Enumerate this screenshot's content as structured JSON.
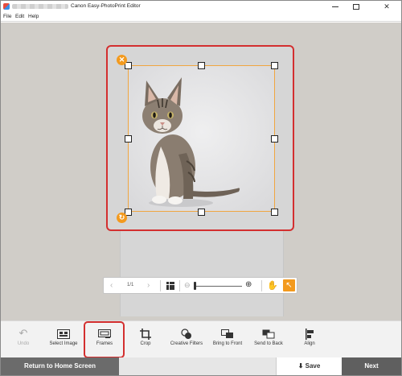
{
  "window": {
    "title": "Canon Easy-PhotoPrint Editor",
    "minimize_glyph": "—",
    "close_glyph": "✕"
  },
  "menu": {
    "file": "File",
    "edit": "Edit",
    "help": "Help"
  },
  "canvas": {
    "delete_glyph": "✕",
    "rotate_glyph": "↻",
    "photo_subject_icon": "kitten-photo"
  },
  "navigation": {
    "prev_glyph": "‹",
    "next_glyph": "›",
    "page_indicator": "1/1",
    "zoom_out_glyph": "⊖",
    "zoom_in_glyph": "⊕",
    "zoom_level": 0.0,
    "hand_glyph": "✋",
    "pointer_glyph": "↖"
  },
  "toolbar": {
    "undo": "Undo",
    "select_image": "Select Image",
    "frames": "Frames",
    "crop": "Crop",
    "creative_filters": "Creative Filters",
    "bring_to_front": "Bring to Front",
    "send_to_back": "Send to Back",
    "align": "Align",
    "undo_glyph": "↶",
    "crop_glyph": "✄"
  },
  "footer": {
    "return_home": "Return to Home Screen",
    "save": "Save",
    "next": "Next",
    "save_glyph": "⬇"
  },
  "colors": {
    "accent_orange": "#f39a1e",
    "highlight_red": "#d32f2f",
    "workspace_bg": "#d0cdc8"
  }
}
